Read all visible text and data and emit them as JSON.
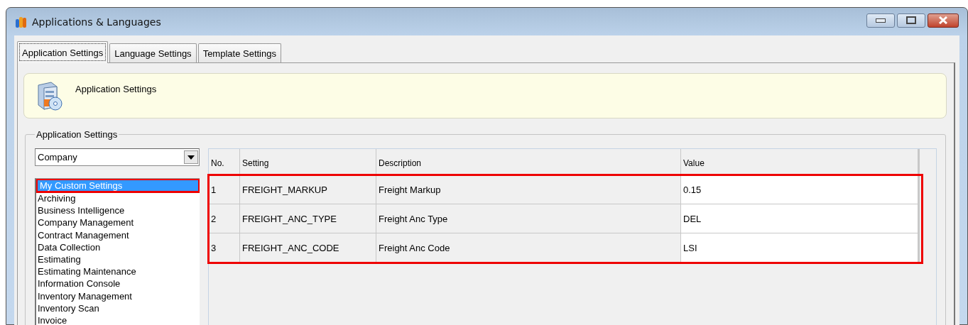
{
  "window": {
    "title": "Applications & Languages"
  },
  "tabs": [
    {
      "label": "Application Settings",
      "selected": true
    },
    {
      "label": "Language Settings",
      "selected": false
    },
    {
      "label": "Template Settings",
      "selected": false
    }
  ],
  "banner": {
    "title": "Application Settings"
  },
  "group": {
    "title": "Application Settings"
  },
  "module_dropdown": {
    "value": "Company"
  },
  "categories": [
    {
      "label": "My Custom Settings",
      "selected": true,
      "outlined": true
    },
    {
      "label": "Archiving",
      "selected": false,
      "outlined": false
    },
    {
      "label": "Business Intelligence",
      "selected": false,
      "outlined": false
    },
    {
      "label": "Company Management",
      "selected": false,
      "outlined": false
    },
    {
      "label": "Contract Management",
      "selected": false,
      "outlined": false
    },
    {
      "label": "Data Collection",
      "selected": false,
      "outlined": false
    },
    {
      "label": "Estimating",
      "selected": false,
      "outlined": false
    },
    {
      "label": "Estimating Maintenance",
      "selected": false,
      "outlined": false
    },
    {
      "label": "Information Console",
      "selected": false,
      "outlined": false
    },
    {
      "label": "Inventory Management",
      "selected": false,
      "outlined": false
    },
    {
      "label": "Inventory Scan",
      "selected": false,
      "outlined": false
    },
    {
      "label": "Invoice",
      "selected": false,
      "outlined": false
    }
  ],
  "table": {
    "columns": [
      "No.",
      "Setting",
      "Description",
      "Value"
    ],
    "rows_outlined": true,
    "rows": [
      [
        "1",
        "FREIGHT_MARKUP",
        "Freight Markup",
        "0.15"
      ],
      [
        "2",
        "FREIGHT_ANC_TYPE",
        "Freight Anc Type",
        "DEL"
      ],
      [
        "3",
        "FREIGHT_ANC_CODE",
        "Freight Anc Code",
        "LSI"
      ]
    ]
  }
}
